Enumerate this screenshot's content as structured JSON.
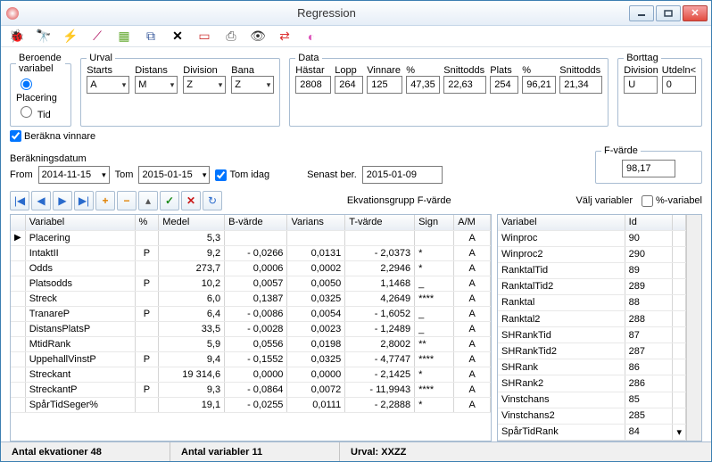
{
  "window": {
    "title": "Regression"
  },
  "groups": {
    "beroende": {
      "legend": "Beroende variabel",
      "placering": "Placering",
      "tid": "Tid"
    },
    "urval": {
      "legend": "Urval",
      "starts": "Starts",
      "distans": "Distans",
      "division": "Division",
      "bana": "Bana",
      "starts_val": "A",
      "distans_val": "M",
      "division_val": "Z",
      "bana_val": "Z"
    },
    "data": {
      "legend": "Data",
      "cols": [
        "Hästar",
        "Lopp",
        "Vinnare",
        "%",
        "Snittodds",
        "Plats",
        "%",
        "Snittodds"
      ],
      "vals": [
        "2808",
        "264",
        "125",
        "47,35",
        "22,63",
        "254",
        "96,21",
        "21,34"
      ]
    },
    "borttag": {
      "legend": "Borttag",
      "division": "Division",
      "utdeln": "Utdeln<",
      "division_val": "U",
      "utdeln_val": "0"
    }
  },
  "berakna": {
    "label": "Beräkna vinnare",
    "datum_label": "Beräkningsdatum",
    "from": "From",
    "tom": "Tom",
    "from_val": "2014-11-15",
    "tom_val": "2015-01-15",
    "tom_idag": "Tom idag",
    "senast": "Senast ber.",
    "senast_val": "2015-01-09"
  },
  "fvarde": {
    "legend": "F-värde",
    "val": "98,17"
  },
  "midrow": {
    "ekv": "Ekvationsgrupp F-värde",
    "valj": "Välj variabler",
    "pct": "%-variabel"
  },
  "left_headers": [
    "Variabel",
    "%",
    "Medel",
    "B-värde",
    "Varians",
    "T-värde",
    "Sign",
    "A/M"
  ],
  "left_rows": [
    {
      "ptr": "▶",
      "v": "Placering",
      "p": "",
      "m": "5,3",
      "b": "",
      "var": "",
      "t": "",
      "s": "",
      "am": "A"
    },
    {
      "ptr": "",
      "v": "IntaktII",
      "p": "P",
      "m": "9,2",
      "b": "- 0,0266",
      "var": "0,0131",
      "t": "- 2,0373",
      "s": "*",
      "am": "A"
    },
    {
      "ptr": "",
      "v": "Odds",
      "p": "",
      "m": "273,7",
      "b": "0,0006",
      "var": "0,0002",
      "t": "2,2946",
      "s": "*",
      "am": "A"
    },
    {
      "ptr": "",
      "v": "Platsodds",
      "p": "P",
      "m": "10,2",
      "b": "0,0057",
      "var": "0,0050",
      "t": "1,1468",
      "s": "_",
      "am": "A"
    },
    {
      "ptr": "",
      "v": "Streck",
      "p": "",
      "m": "6,0",
      "b": "0,1387",
      "var": "0,0325",
      "t": "4,2649",
      "s": "****",
      "am": "A"
    },
    {
      "ptr": "",
      "v": "TranareP",
      "p": "P",
      "m": "6,4",
      "b": "- 0,0086",
      "var": "0,0054",
      "t": "- 1,6052",
      "s": "_",
      "am": "A"
    },
    {
      "ptr": "",
      "v": "DistansPlatsP",
      "p": "",
      "m": "33,5",
      "b": "- 0,0028",
      "var": "0,0023",
      "t": "- 1,2489",
      "s": "_",
      "am": "A"
    },
    {
      "ptr": "",
      "v": "MtidRank",
      "p": "",
      "m": "5,9",
      "b": "0,0556",
      "var": "0,0198",
      "t": "2,8002",
      "s": "**",
      "am": "A"
    },
    {
      "ptr": "",
      "v": "UppehallVinstP",
      "p": "P",
      "m": "9,4",
      "b": "- 0,1552",
      "var": "0,0325",
      "t": "- 4,7747",
      "s": "****",
      "am": "A"
    },
    {
      "ptr": "",
      "v": "Streckant",
      "p": "",
      "m": "19 314,6",
      "b": "0,0000",
      "var": "0,0000",
      "t": "- 2,1425",
      "s": "*",
      "am": "A"
    },
    {
      "ptr": "",
      "v": "StreckantP",
      "p": "P",
      "m": "9,3",
      "b": "- 0,0864",
      "var": "0,0072",
      "t": "- 11,9943",
      "s": "****",
      "am": "A"
    },
    {
      "ptr": "",
      "v": "SpårTidSeger%",
      "p": "",
      "m": "19,1",
      "b": "- 0,0255",
      "var": "0,0111",
      "t": "- 2,2888",
      "s": "*",
      "am": "A"
    }
  ],
  "right_headers": [
    "Variabel",
    "Id"
  ],
  "right_rows": [
    {
      "v": "Winproc",
      "id": "90"
    },
    {
      "v": "Winproc2",
      "id": "290"
    },
    {
      "v": "RanktalTid",
      "id": "89"
    },
    {
      "v": "RanktalTid2",
      "id": "289"
    },
    {
      "v": "Ranktal",
      "id": "88"
    },
    {
      "v": "Ranktal2",
      "id": "288"
    },
    {
      "v": "SHRankTid",
      "id": "87"
    },
    {
      "v": "SHRankTid2",
      "id": "287"
    },
    {
      "v": "SHRank",
      "id": "86"
    },
    {
      "v": "SHRank2",
      "id": "286"
    },
    {
      "v": "Vinstchans",
      "id": "85"
    },
    {
      "v": "Vinstchans2",
      "id": "285"
    },
    {
      "v": "SpårTidRank",
      "id": "84"
    }
  ],
  "status": {
    "antal_ekv": "Antal ekvationer 48",
    "antal_var": "Antal variabler 11",
    "urval": "Urval: XXZZ"
  }
}
